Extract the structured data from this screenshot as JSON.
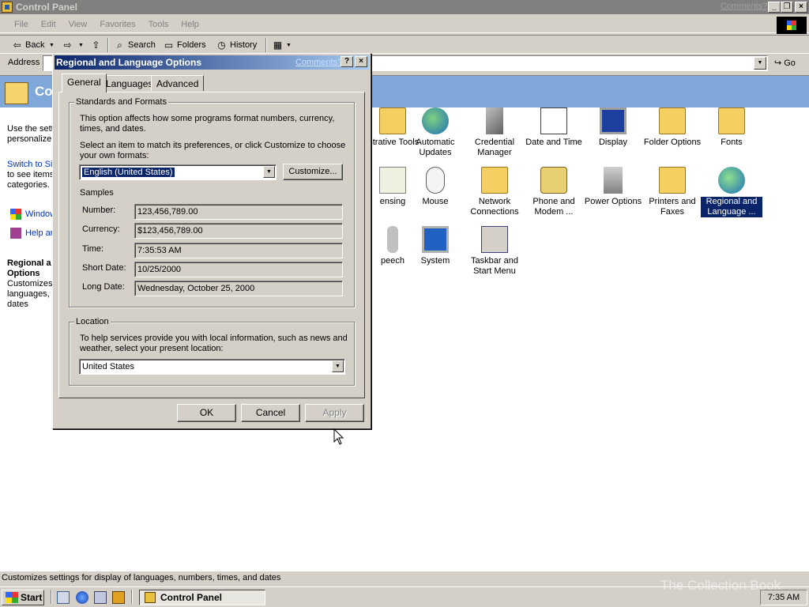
{
  "window": {
    "title": "Control Panel",
    "comments_link": "Comments?"
  },
  "menu": [
    "File",
    "Edit",
    "View",
    "Favorites",
    "Tools",
    "Help"
  ],
  "toolbar": {
    "back": "Back",
    "search": "Search",
    "folders": "Folders",
    "history": "History"
  },
  "address": {
    "label": "Address",
    "go": "Go"
  },
  "left_pane": {
    "title": "Co",
    "desc_lines": [
      "Use the sett",
      "personalize"
    ],
    "switch_lines": [
      "Switch to Si",
      "to see items",
      "categories."
    ],
    "link1": "Window",
    "link2": "Help ar",
    "sel_title_lines": [
      "Regional a",
      "Options"
    ],
    "sel_desc_lines": [
      "Customizes",
      "languages,",
      "dates"
    ]
  },
  "icons": [
    {
      "label": "istrative Tools"
    },
    {
      "label": "Automatic Updates"
    },
    {
      "label": "Credential Manager"
    },
    {
      "label": "Date and Time"
    },
    {
      "label": "Display"
    },
    {
      "label": "Folder Options"
    },
    {
      "label": "Fonts"
    },
    {
      "label": "ensing"
    },
    {
      "label": "Mouse"
    },
    {
      "label": "Network Connections"
    },
    {
      "label": "Phone and Modem ..."
    },
    {
      "label": "Power Options"
    },
    {
      "label": "Printers and Faxes"
    },
    {
      "label": "Regional and Language ..."
    },
    {
      "label": "peech"
    },
    {
      "label": "System"
    },
    {
      "label": "Taskbar and Start Menu"
    }
  ],
  "dialog": {
    "title": "Regional and Language Options",
    "comments_link": "Comments?",
    "help_btn": "?",
    "close_btn": "×",
    "tabs": [
      "General",
      "Languages",
      "Advanced"
    ],
    "standards": {
      "legend": "Standards and Formats",
      "desc": "This option affects how some programs format numbers, currency, times, and dates.",
      "select_prompt": "Select an item to match its preferences, or click Customize to choose your own formats:",
      "selected_locale": "English (United States)",
      "customize_btn": "Customize...",
      "samples_label": "Samples",
      "samples": [
        {
          "label": "Number:",
          "value": "123,456,789.00"
        },
        {
          "label": "Currency:",
          "value": "$123,456,789.00"
        },
        {
          "label": "Time:",
          "value": "7:35:53 AM"
        },
        {
          "label": "Short Date:",
          "value": "10/25/2000"
        },
        {
          "label": "Long Date:",
          "value": "Wednesday, October 25, 2000"
        }
      ]
    },
    "location": {
      "legend": "Location",
      "desc": "To help services provide you with local information, such as news and weather, select your present location:",
      "value": "United States"
    },
    "buttons": {
      "ok": "OK",
      "cancel": "Cancel",
      "apply": "Apply"
    }
  },
  "statusbar": {
    "text": "Customizes settings for display of languages, numbers, times, and dates"
  },
  "taskbar": {
    "start": "Start",
    "task": "Control Panel",
    "clock": "7:35 AM"
  },
  "watermark": "The Collection Book"
}
